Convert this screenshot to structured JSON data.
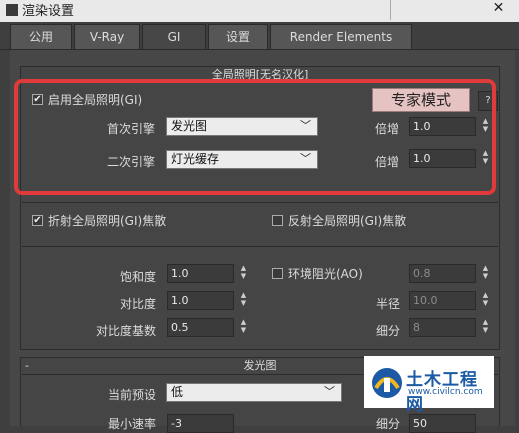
{
  "window": {
    "title": "渲染设置",
    "close": "✕"
  },
  "tabs": [
    {
      "label": "公用"
    },
    {
      "label": "V-Ray"
    },
    {
      "label": "GI"
    },
    {
      "label": "设置"
    },
    {
      "label": "Render Elements"
    }
  ],
  "gi_rollout": {
    "title": "全局照明[无名汉化]",
    "enable_gi_label": "启用全局照明(GI)",
    "enable_gi_checked": true,
    "expert_mode_label": "专家模式",
    "help_label": "?",
    "primary_engine_label": "首次引擎",
    "primary_engine_value": "发光图",
    "primary_multiplier_label": "倍增",
    "primary_multiplier_value": "1.0",
    "secondary_engine_label": "二次引擎",
    "secondary_engine_value": "灯光缓存",
    "secondary_multiplier_label": "倍增",
    "secondary_multiplier_value": "1.0",
    "refractive_caustics_label": "折射全局照明(GI)焦散",
    "refractive_caustics_checked": true,
    "reflective_caustics_label": "反射全局照明(GI)焦散",
    "reflective_caustics_checked": false,
    "saturation_label": "饱和度",
    "saturation_value": "1.0",
    "contrast_label": "对比度",
    "contrast_value": "1.0",
    "contrast_base_label": "对比度基数",
    "contrast_base_value": "0.5",
    "ao_label": "环境阻光(AO)",
    "ao_checked": false,
    "ao_value": "0.8",
    "radius_label": "半径",
    "radius_value": "10.0",
    "subdivs_label": "细分",
    "subdivs_value": "8"
  },
  "irradiance_rollout": {
    "collapse": "-",
    "title": "发光图",
    "preset_label": "当前预设",
    "preset_value": "低",
    "min_rate_label": "最小速率",
    "min_rate_value": "-3",
    "subdivs_label": "细分",
    "subdivs_value": "50"
  },
  "watermark": {
    "name": "土木工程网",
    "url": "www.civilcn.com"
  }
}
